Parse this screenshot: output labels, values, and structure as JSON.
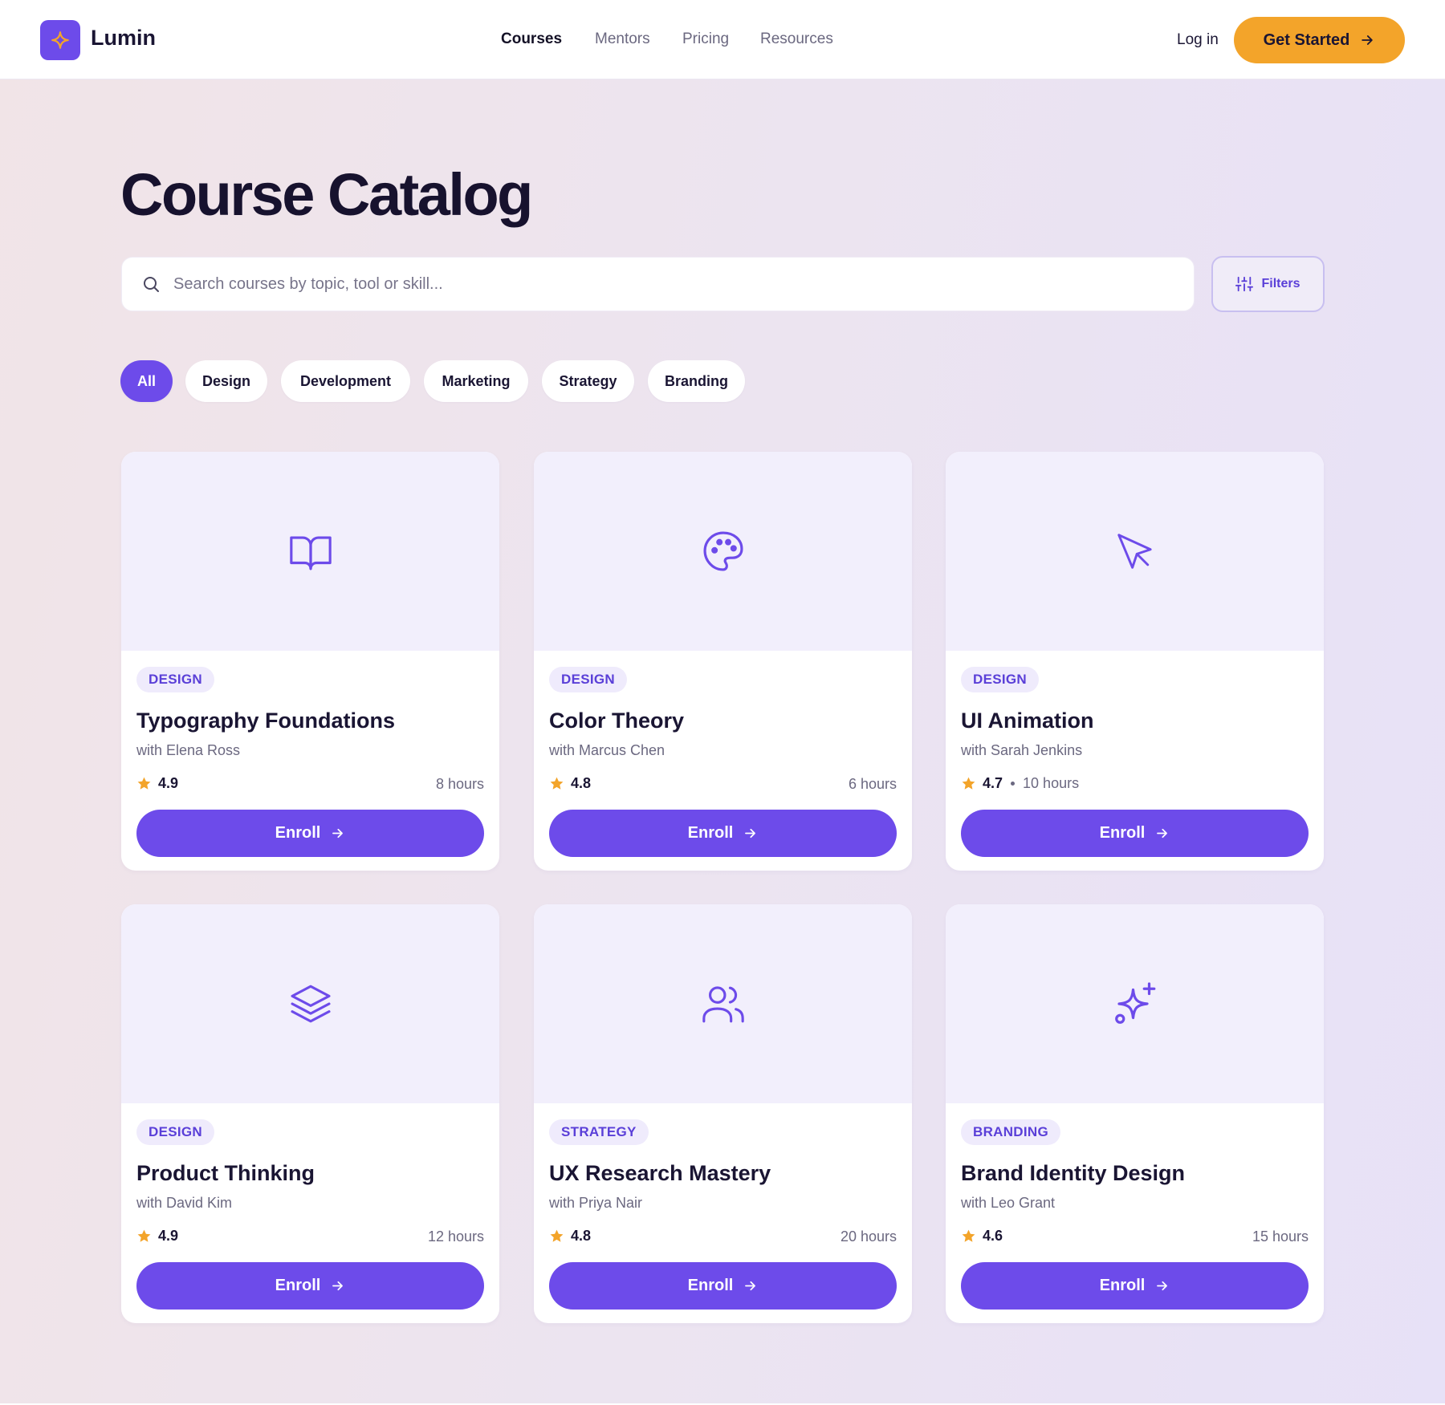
{
  "brand": {
    "name": "Lumin"
  },
  "nav": [
    {
      "label": "Courses",
      "active": true
    },
    {
      "label": "Mentors",
      "active": false
    },
    {
      "label": "Pricing",
      "active": false
    },
    {
      "label": "Resources",
      "active": false
    }
  ],
  "header": {
    "login": "Log in",
    "cta": "Get Started"
  },
  "page": {
    "title": "Course Catalog"
  },
  "search": {
    "placeholder": "Search courses by topic, tool or skill...",
    "value": ""
  },
  "filters_label": "Filters",
  "categories": [
    {
      "label": "All",
      "active": true
    },
    {
      "label": "Design",
      "active": false
    },
    {
      "label": "Development",
      "active": false
    },
    {
      "label": "Marketing",
      "active": false
    },
    {
      "label": "Strategy",
      "active": false
    },
    {
      "label": "Branding",
      "active": false
    }
  ],
  "courses": [
    {
      "tag": "DESIGN",
      "title": "Typography Foundations",
      "mentor": "with Elena Ross",
      "rating": "4.9",
      "hours": "8 hours",
      "icon": "book-open-icon",
      "enroll": "Enroll"
    },
    {
      "tag": "DESIGN",
      "title": "Color Theory",
      "mentor": "with Marcus Chen",
      "rating": "4.8",
      "hours": "6 hours",
      "icon": "palette-icon",
      "enroll": "Enroll"
    },
    {
      "tag": "DESIGN",
      "title": "UI Animation",
      "mentor": "with Sarah Jenkins",
      "rating": "4.7",
      "hours": "10 hours",
      "icon": "cursor-pointer-icon",
      "enroll": "Enroll"
    },
    {
      "tag": "DESIGN",
      "title": "Product Thinking",
      "mentor": "with David Kim",
      "rating": "4.9",
      "hours": "12 hours",
      "icon": "layers-icon",
      "enroll": "Enroll"
    },
    {
      "tag": "STRATEGY",
      "title": "UX Research Mastery",
      "mentor": "with Priya Nair",
      "rating": "4.8",
      "hours": "20 hours",
      "icon": "users-icon",
      "enroll": "Enroll"
    },
    {
      "tag": "BRANDING",
      "title": "Brand Identity Design",
      "mentor": "with Leo Grant",
      "rating": "4.6",
      "hours": "15 hours",
      "icon": "sparkles-icon",
      "enroll": "Enroll"
    }
  ],
  "colors": {
    "accent": "#6d4bea",
    "cta": "#f3a42a",
    "star": "#f3a42a",
    "text": "#1a1533",
    "muted": "#6b6880"
  }
}
